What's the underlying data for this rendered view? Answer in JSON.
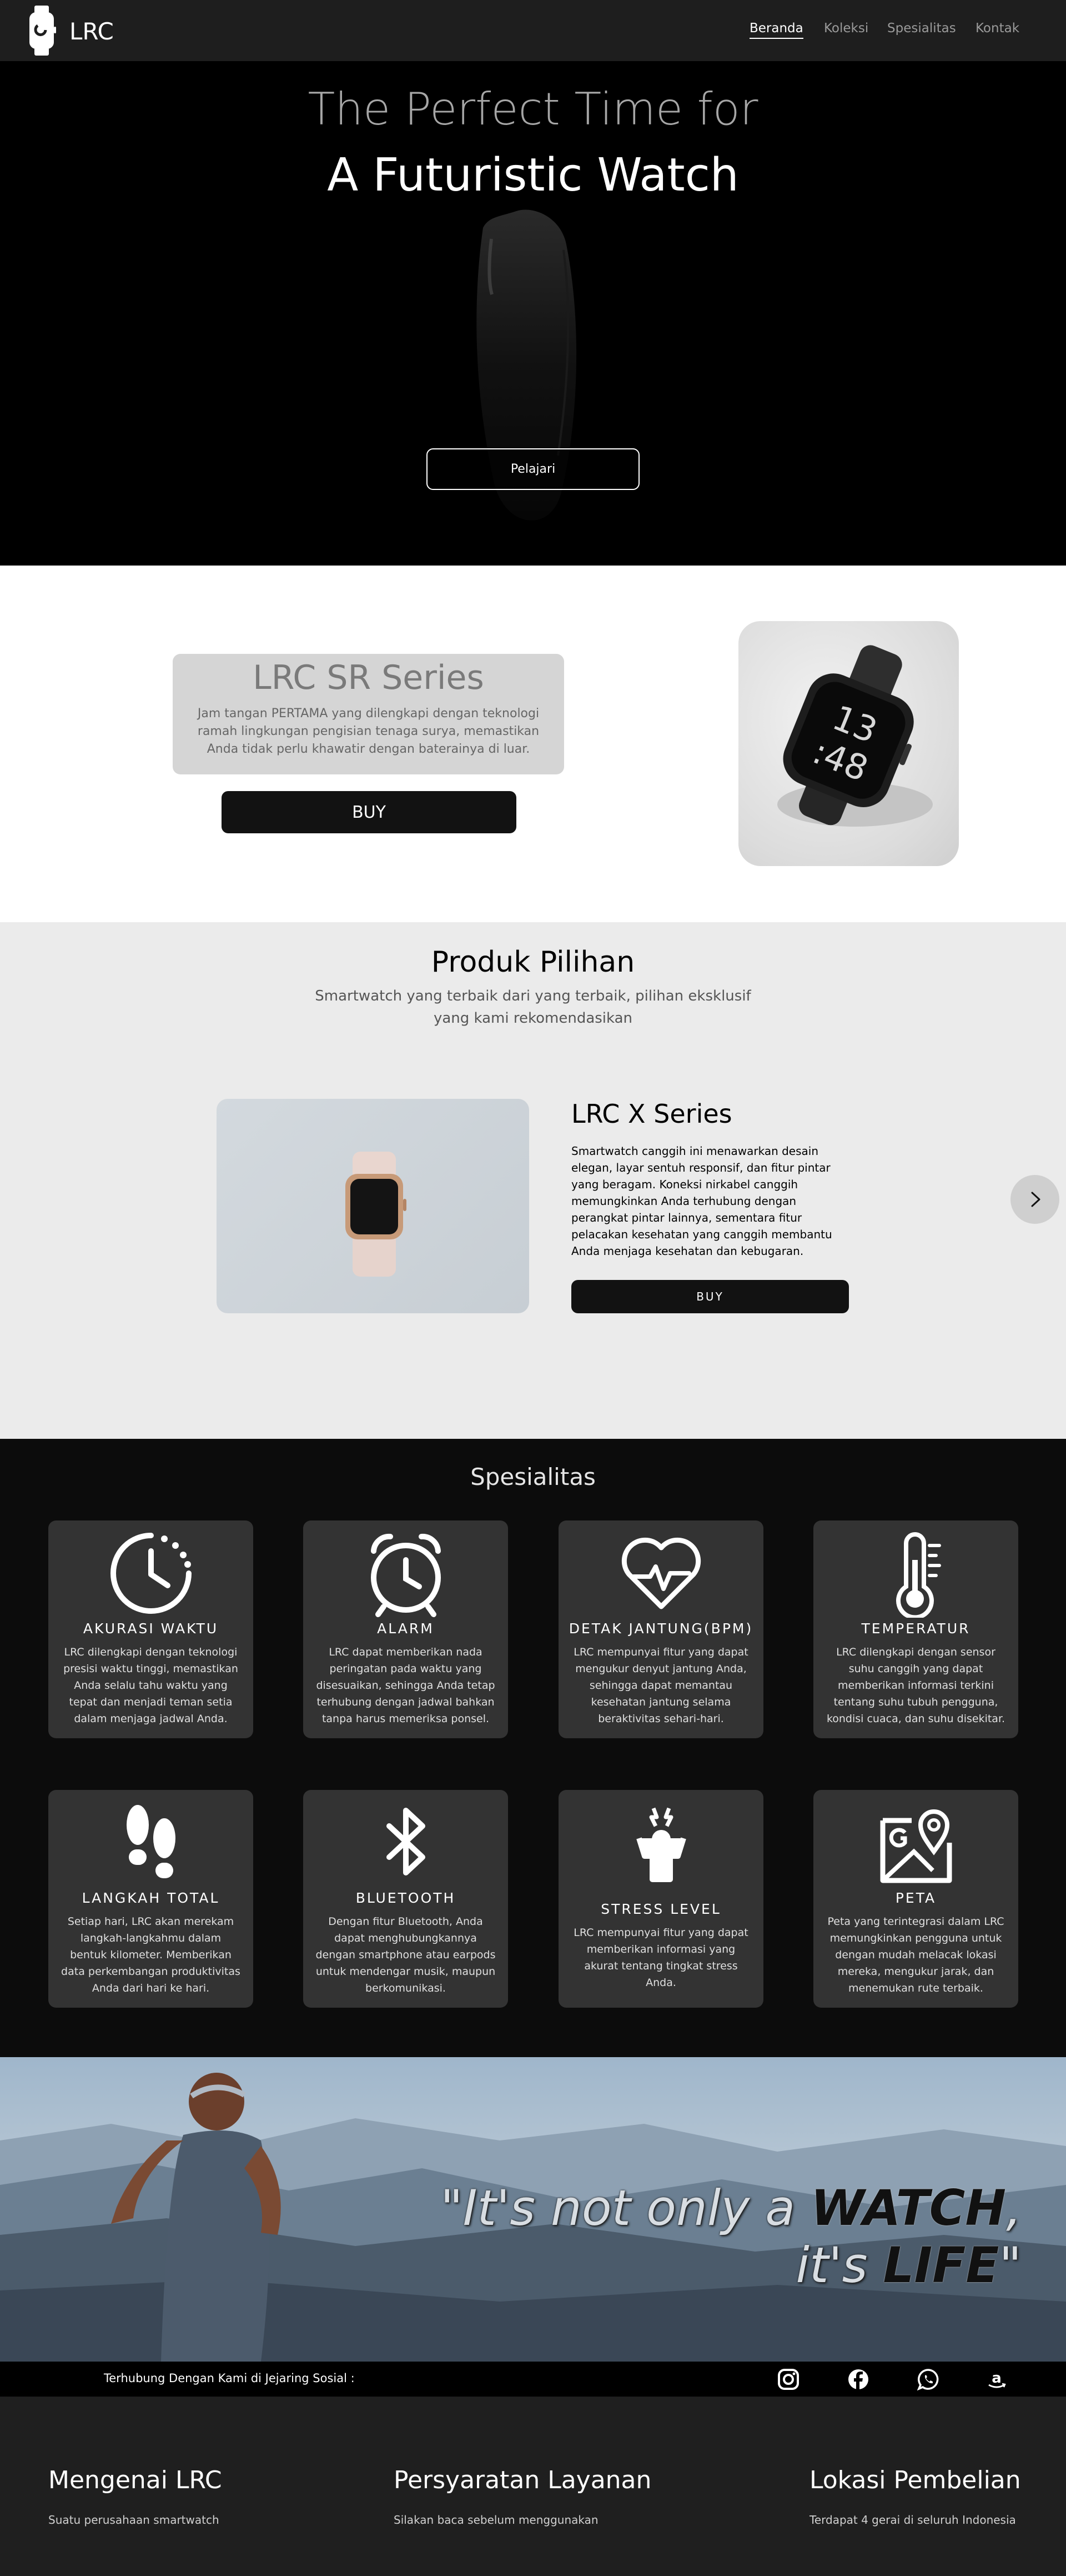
{
  "nav": {
    "brand": "LRC",
    "links": [
      "Beranda",
      "Koleksi",
      "Spesialitas",
      "Kontak"
    ]
  },
  "hero": {
    "line1": "The Perfect Time for",
    "line2": "A Futuristic Watch",
    "button": "Pelajari"
  },
  "sr_series": {
    "title": "LRC SR Series",
    "description": "Jam tangan PERTAMA yang dilengkapi dengan teknologi ramah lingkungan pengisian tenaga surya, memastikan Anda tidak perlu khawatir dengan baterainya di luar.",
    "buy": "BUY",
    "watch_time_hour": "13",
    "watch_time_min": ":48"
  },
  "produk_pilihan": {
    "title": "Produk Pilihan",
    "subtitle": "Smartwatch yang terbaik dari yang terbaik, pilihan eksklusif yang kami rekomendasikan",
    "product_name": "LRC X Series",
    "product_desc": "Smartwatch canggih ini menawarkan desain elegan, layar sentuh responsif, dan fitur pintar yang beragam. Koneksi nirkabel canggih memungkinkan Anda terhubung dengan perangkat pintar lainnya, sementara fitur pelacakan kesehatan yang canggih membantu Anda menjaga kesehatan dan kebugaran.",
    "buy": "BUY",
    "next_icon": "chevron-right-icon"
  },
  "spesialitas": {
    "title": "Spesialitas",
    "features": [
      {
        "icon": "clock-history-icon",
        "title": "AKURASI WAKTU",
        "desc": "LRC dilengkapi dengan teknologi presisi waktu tinggi, memastikan Anda selalu tahu waktu yang tepat dan menjadi teman setia dalam menjaga jadwal Anda."
      },
      {
        "icon": "alarm-clock-icon",
        "title": "ALARM",
        "desc": "LRC dapat memberikan nada peringatan pada waktu yang disesuaikan, sehingga Anda tetap terhubung dengan jadwal bahkan tanpa harus memeriksa ponsel."
      },
      {
        "icon": "heart-pulse-icon",
        "title": "DETAK JANTUNG(BPM)",
        "desc": "LRC mempunyai fitur yang dapat mengukur denyut jantung Anda, sehingga dapat memantau kesehatan jantung selama beraktivitas sehari-hari."
      },
      {
        "icon": "thermometer-icon",
        "title": "TEMPERATUR",
        "desc": "LRC dilengkapi dengan sensor suhu canggih yang dapat memberikan informasi terkini tentang suhu tubuh pengguna, kondisi cuaca, dan suhu disekitar."
      },
      {
        "icon": "footprints-icon",
        "title": "LANGKAH TOTAL",
        "desc": "Setiap hari, LRC akan merekam langkah-langkahmu dalam bentuk kilometer. Memberikan data perkembangan produktivitas Anda dari hari ke hari."
      },
      {
        "icon": "bluetooth-icon",
        "title": "BLUETOOTH",
        "desc": "Dengan fitur Bluetooth, Anda dapat menghubungkannya dengan smartphone atau earpods untuk mendengar musik, maupun berkomunikasi."
      },
      {
        "icon": "stress-person-icon",
        "title": "STRESS LEVEL",
        "desc": "LRC mempunyai fitur yang dapat memberikan informasi yang akurat tentang tingkat stress Anda."
      },
      {
        "icon": "map-pin-icon",
        "title": "PETA",
        "desc": "Peta yang terintegrasi dalam LRC memungkinkan pengguna untuk dengan mudah melacak lokasi mereka, mengukur jarak, dan menemukan rute terbaik."
      }
    ]
  },
  "life": {
    "q_open": "\"It's not only a ",
    "q_watch": "WATCH",
    "q_mid": ", it's ",
    "q_life": "LIFE",
    "q_close": "\""
  },
  "social": {
    "text": "Terhubung Dengan Kami di Jejaring Sosial :",
    "icons": [
      "instagram-icon",
      "facebook-icon",
      "whatsapp-icon",
      "amazon-icon"
    ]
  },
  "footer": {
    "col1_title": "Mengenai LRC",
    "col1_text": "Suatu perusahaan smartwatch",
    "col2_title": "Persyaratan Layanan",
    "col2_text": "Silakan baca sebelum menggunakan",
    "col3_title": "Lokasi Pembelian",
    "col3_text": "Terdapat 4 gerai di seluruh Indonesia"
  }
}
